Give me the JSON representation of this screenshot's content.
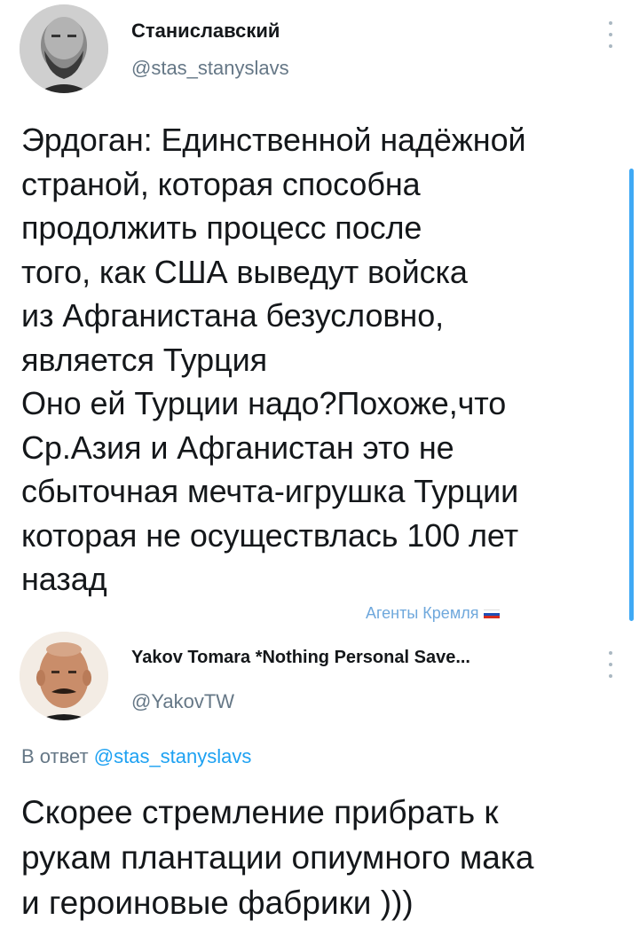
{
  "tweets": [
    {
      "display_name": "Станиславский",
      "handle": "@stas_stanyslavs",
      "avatar_icon": "profile-photo-bearded-man",
      "more_icon": "vertical-ellipsis-icon",
      "text": "Эрдоган: Единственной надёжной\nстраной, которая способна\nпродолжить процесс после\nтого, как США выведут войска\nиз Афганистана безусловно,\nявляется Турция\nОно ей Турции надо?Похоже,что\nСр.Азия и Афганистан это не\nсбыточная мечта-игрушка Турции\nкоторая не осуществлась 100 лет\nназад"
    },
    {
      "display_name": "Yakov Tomara *Nothing Personal Save...",
      "handle": "@YakovTW",
      "avatar_icon": "profile-photo-man-mustache",
      "more_icon": "vertical-ellipsis-icon",
      "reply_prefix": "В ответ",
      "reply_handle": "@stas_stanyslavs",
      "text": "Скорее стремление прибрать к\nрукам плантации опиумного мака\nи героиновые фабрики )))"
    }
  ],
  "watermark": {
    "text": "Агенты Кремля",
    "flag_icon": "russian-flag-icon"
  },
  "colors": {
    "text": "#14171a",
    "secondary": "#657786",
    "link": "#1da1f2",
    "scrollbar": "#3fa9f5"
  }
}
